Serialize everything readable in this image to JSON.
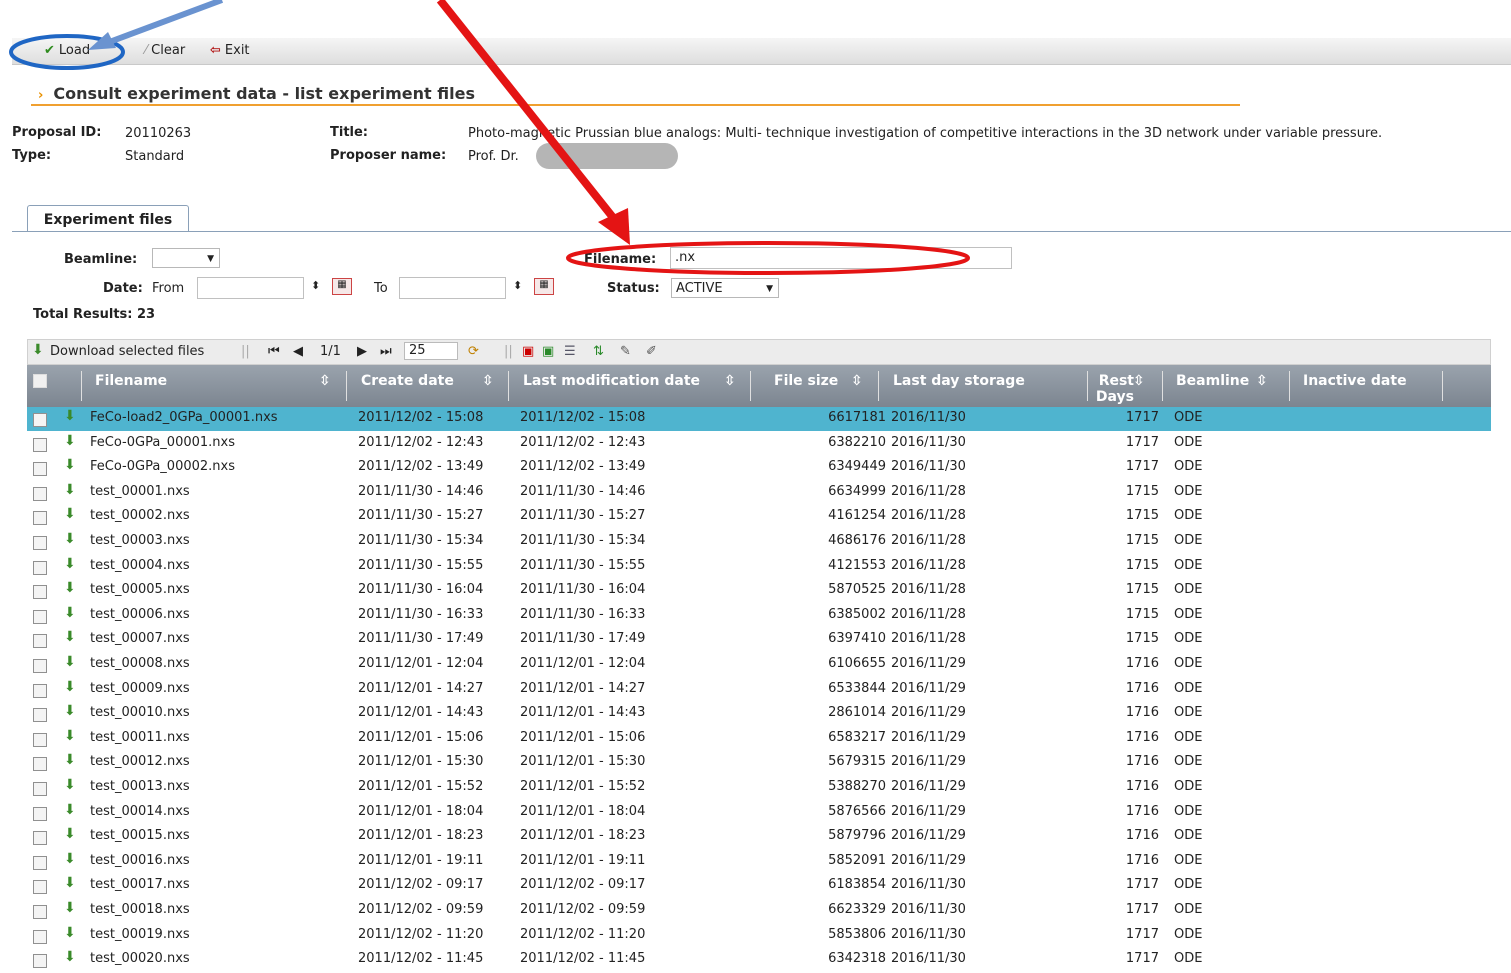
{
  "toolbar": {
    "load": "Load",
    "clear": "Clear",
    "exit": "Exit"
  },
  "section": {
    "title": "Consult experiment data - list experiment files"
  },
  "proposal": {
    "id_label": "Proposal ID:",
    "id_value": "20110263",
    "type_label": "Type:",
    "type_value": "Standard",
    "title_label": "Title:",
    "title_value": "Photo-magnetic Prussian blue analogs: Multi- technique investigation of competitive interactions in the 3D network under variable pressure.",
    "proposer_label": "Proposer name:",
    "proposer_value": "Prof. Dr."
  },
  "tab": {
    "label": "Experiment files"
  },
  "filters": {
    "beamline_label": "Beamline:",
    "beamline_value": "",
    "date_label": "Date:",
    "from_label": "From",
    "to_label": "To",
    "filename_label": "Filename:",
    "filename_value": ".nx",
    "status_label": "Status:",
    "status_value": "ACTIVE",
    "total_label": "Total Results: 23"
  },
  "gridbar": {
    "download": "Download selected files",
    "page": "1/1",
    "page_size": "25"
  },
  "columns": {
    "filename": "Filename",
    "create_date": "Create date",
    "last_mod": "Last modification date",
    "file_size": "File size",
    "last_day": "Last day storage",
    "rest_days": "Rest Days",
    "beamline": "Beamline",
    "inactive": "Inactive date"
  },
  "rows": [
    {
      "name": "FeCo-load2_0GPa_00001.nxs",
      "create": "2011/12/02 - 15:08",
      "mod": "2011/12/02 - 15:08",
      "size": "6617181",
      "last": "2016/11/30",
      "rest": "1717",
      "bl": "ODE"
    },
    {
      "name": "FeCo-0GPa_00001.nxs",
      "create": "2011/12/02 - 12:43",
      "mod": "2011/12/02 - 12:43",
      "size": "6382210",
      "last": "2016/11/30",
      "rest": "1717",
      "bl": "ODE"
    },
    {
      "name": "FeCo-0GPa_00002.nxs",
      "create": "2011/12/02 - 13:49",
      "mod": "2011/12/02 - 13:49",
      "size": "6349449",
      "last": "2016/11/30",
      "rest": "1717",
      "bl": "ODE"
    },
    {
      "name": "test_00001.nxs",
      "create": "2011/11/30 - 14:46",
      "mod": "2011/11/30 - 14:46",
      "size": "6634999",
      "last": "2016/11/28",
      "rest": "1715",
      "bl": "ODE"
    },
    {
      "name": "test_00002.nxs",
      "create": "2011/11/30 - 15:27",
      "mod": "2011/11/30 - 15:27",
      "size": "4161254",
      "last": "2016/11/28",
      "rest": "1715",
      "bl": "ODE"
    },
    {
      "name": "test_00003.nxs",
      "create": "2011/11/30 - 15:34",
      "mod": "2011/11/30 - 15:34",
      "size": "4686176",
      "last": "2016/11/28",
      "rest": "1715",
      "bl": "ODE"
    },
    {
      "name": "test_00004.nxs",
      "create": "2011/11/30 - 15:55",
      "mod": "2011/11/30 - 15:55",
      "size": "4121553",
      "last": "2016/11/28",
      "rest": "1715",
      "bl": "ODE"
    },
    {
      "name": "test_00005.nxs",
      "create": "2011/11/30 - 16:04",
      "mod": "2011/11/30 - 16:04",
      "size": "5870525",
      "last": "2016/11/28",
      "rest": "1715",
      "bl": "ODE"
    },
    {
      "name": "test_00006.nxs",
      "create": "2011/11/30 - 16:33",
      "mod": "2011/11/30 - 16:33",
      "size": "6385002",
      "last": "2016/11/28",
      "rest": "1715",
      "bl": "ODE"
    },
    {
      "name": "test_00007.nxs",
      "create": "2011/11/30 - 17:49",
      "mod": "2011/11/30 - 17:49",
      "size": "6397410",
      "last": "2016/11/28",
      "rest": "1715",
      "bl": "ODE"
    },
    {
      "name": "test_00008.nxs",
      "create": "2011/12/01 - 12:04",
      "mod": "2011/12/01 - 12:04",
      "size": "6106655",
      "last": "2016/11/29",
      "rest": "1716",
      "bl": "ODE"
    },
    {
      "name": "test_00009.nxs",
      "create": "2011/12/01 - 14:27",
      "mod": "2011/12/01 - 14:27",
      "size": "6533844",
      "last": "2016/11/29",
      "rest": "1716",
      "bl": "ODE"
    },
    {
      "name": "test_00010.nxs",
      "create": "2011/12/01 - 14:43",
      "mod": "2011/12/01 - 14:43",
      "size": "2861014",
      "last": "2016/11/29",
      "rest": "1716",
      "bl": "ODE"
    },
    {
      "name": "test_00011.nxs",
      "create": "2011/12/01 - 15:06",
      "mod": "2011/12/01 - 15:06",
      "size": "6583217",
      "last": "2016/11/29",
      "rest": "1716",
      "bl": "ODE"
    },
    {
      "name": "test_00012.nxs",
      "create": "2011/12/01 - 15:30",
      "mod": "2011/12/01 - 15:30",
      "size": "5679315",
      "last": "2016/11/29",
      "rest": "1716",
      "bl": "ODE"
    },
    {
      "name": "test_00013.nxs",
      "create": "2011/12/01 - 15:52",
      "mod": "2011/12/01 - 15:52",
      "size": "5388270",
      "last": "2016/11/29",
      "rest": "1716",
      "bl": "ODE"
    },
    {
      "name": "test_00014.nxs",
      "create": "2011/12/01 - 18:04",
      "mod": "2011/12/01 - 18:04",
      "size": "5876566",
      "last": "2016/11/29",
      "rest": "1716",
      "bl": "ODE"
    },
    {
      "name": "test_00015.nxs",
      "create": "2011/12/01 - 18:23",
      "mod": "2011/12/01 - 18:23",
      "size": "5879796",
      "last": "2016/11/29",
      "rest": "1716",
      "bl": "ODE"
    },
    {
      "name": "test_00016.nxs",
      "create": "2011/12/01 - 19:11",
      "mod": "2011/12/01 - 19:11",
      "size": "5852091",
      "last": "2016/11/29",
      "rest": "1716",
      "bl": "ODE"
    },
    {
      "name": "test_00017.nxs",
      "create": "2011/12/02 - 09:17",
      "mod": "2011/12/02 - 09:17",
      "size": "6183854",
      "last": "2016/11/30",
      "rest": "1717",
      "bl": "ODE"
    },
    {
      "name": "test_00018.nxs",
      "create": "2011/12/02 - 09:59",
      "mod": "2011/12/02 - 09:59",
      "size": "6623329",
      "last": "2016/11/30",
      "rest": "1717",
      "bl": "ODE"
    },
    {
      "name": "test_00019.nxs",
      "create": "2011/12/02 - 11:20",
      "mod": "2011/12/02 - 11:20",
      "size": "5853806",
      "last": "2016/11/30",
      "rest": "1717",
      "bl": "ODE"
    },
    {
      "name": "test_00020.nxs",
      "create": "2011/12/02 - 11:45",
      "mod": "2011/12/02 - 11:45",
      "size": "6342318",
      "last": "2016/11/30",
      "rest": "1717",
      "bl": "ODE"
    }
  ],
  "colors": {
    "selected_row": "#4fb4cf",
    "header": "#8a939d",
    "accent": "#f0a030"
  }
}
